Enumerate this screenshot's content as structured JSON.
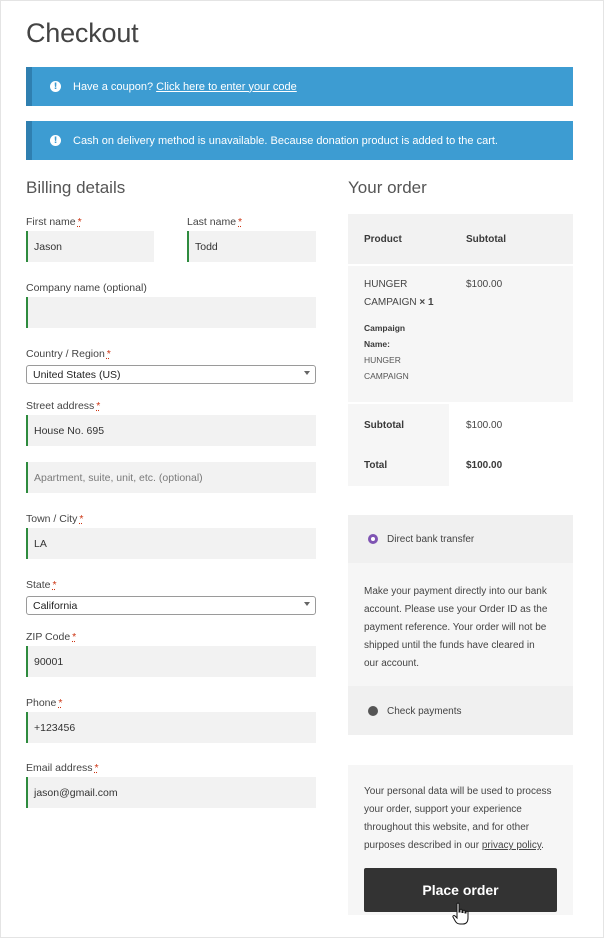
{
  "page": {
    "title": "Checkout"
  },
  "notices": {
    "coupon_text": "Have a coupon?",
    "coupon_link": "Click here to enter your code",
    "cod_text": "Cash on delivery method is unavailable. Because donation product is added to the cart."
  },
  "billing": {
    "title": "Billing details",
    "first_name": {
      "label": "First name",
      "value": "Jason"
    },
    "last_name": {
      "label": "Last name",
      "value": "Todd"
    },
    "company": {
      "label": "Company name (optional)",
      "value": ""
    },
    "country": {
      "label": "Country / Region",
      "value": "United States (US)"
    },
    "street": {
      "label": "Street address",
      "value": "House No. 695",
      "placeholder2": "Apartment, suite, unit, etc. (optional)"
    },
    "city": {
      "label": "Town / City",
      "value": "LA"
    },
    "state": {
      "label": "State",
      "value": "California"
    },
    "zip": {
      "label": "ZIP Code",
      "value": "90001"
    },
    "phone": {
      "label": "Phone",
      "value": "+123456"
    },
    "email": {
      "label": "Email address",
      "value": "jason@gmail.com"
    },
    "required_mark": "*"
  },
  "order": {
    "title": "Your order",
    "col_product": "Product",
    "col_subtotal": "Subtotal",
    "item_line1": "HUNGER",
    "item_line2": "CAMPAIGN",
    "item_qty": "× 1",
    "item_price": "$100.00",
    "meta_line1": "Campaign",
    "meta_line2": "Name:",
    "meta_line3": "HUNGER",
    "meta_line4": "CAMPAIGN",
    "subtotal_label": "Subtotal",
    "subtotal_value": "$100.00",
    "total_label": "Total",
    "total_value": "$100.00"
  },
  "payment": {
    "bank_label": "Direct bank transfer",
    "bank_desc": [
      "Make your payment directly into our bank",
      "account. Please use your Order ID as the",
      "payment reference. Your order will not be",
      "shipped until the funds have cleared in",
      "our account."
    ],
    "check_label": "Check payments",
    "selected_color": "#7f54b3"
  },
  "privacy": {
    "lines": [
      "Your personal data will be used to process",
      "your order, support your experience",
      "throughout this website, and for other"
    ],
    "last_line_prefix": "purposes described in our",
    "link": "privacy policy",
    "suffix": "."
  },
  "place_order": {
    "label": "Place order"
  }
}
